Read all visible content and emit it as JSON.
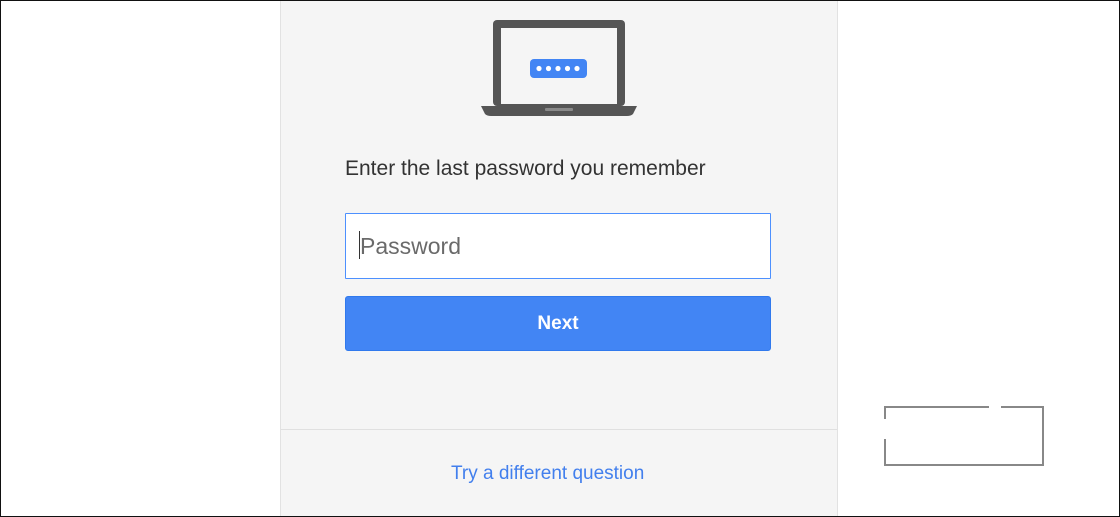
{
  "recovery": {
    "prompt": "Enter the last password you remember",
    "password": {
      "placeholder": "Password",
      "value": ""
    },
    "next_label": "Next",
    "alternate_link": "Try a different question"
  },
  "icons": {
    "illustration": "laptop-password-icon"
  },
  "colors": {
    "accent": "#4285f4",
    "link": "#427fed",
    "card_background": "#f5f5f5",
    "laptop": "#555555"
  }
}
